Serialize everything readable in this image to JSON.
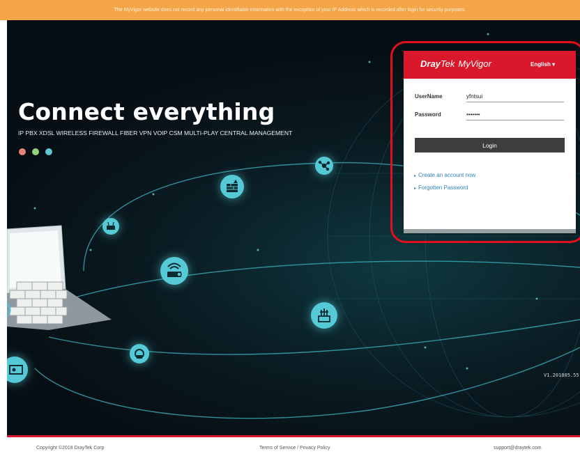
{
  "notice": {
    "text": "The MyVigor website does not record any personal identifiable information with the exception of your IP Address which is recorded after login for security purposes."
  },
  "hero": {
    "headline": "Connect everything",
    "tagline": "IP PBX XDSL WIRELESS FIREWALL FIBER VPN VOIP CSM MULTI-PLAY CENTRAL MANAGEMENT",
    "dot_colors": [
      "#e8857a",
      "#8fd17c",
      "#5fc6d3"
    ],
    "version": "V1.201805.55"
  },
  "login": {
    "brand_main": "Dray",
    "brand_tek": "Tek",
    "brand_product": "MyVigor",
    "language": "English ▾",
    "username_label": "UserName",
    "username_value": "yfntsui",
    "password_label": "Password",
    "password_value": "•••••••",
    "login_button": "Login",
    "create_account": "Create an account now",
    "forgotten_password": "Forgotten Password",
    "accent_color": "#d9192b"
  },
  "footer": {
    "copyright": "Copyright ©2018 DrayTek Corp",
    "terms": "Terms of Service / Privacy Policy",
    "email": "support@draytek.com"
  },
  "colors": {
    "notice_bar": "#f3a547",
    "node": "#55c9d6",
    "highlight": "#e2101e"
  },
  "icons": [
    "network-icon",
    "firewall-icon",
    "router-icon",
    "wifi-router-icon",
    "switch-icon",
    "voip-icon",
    "display-icon"
  ]
}
